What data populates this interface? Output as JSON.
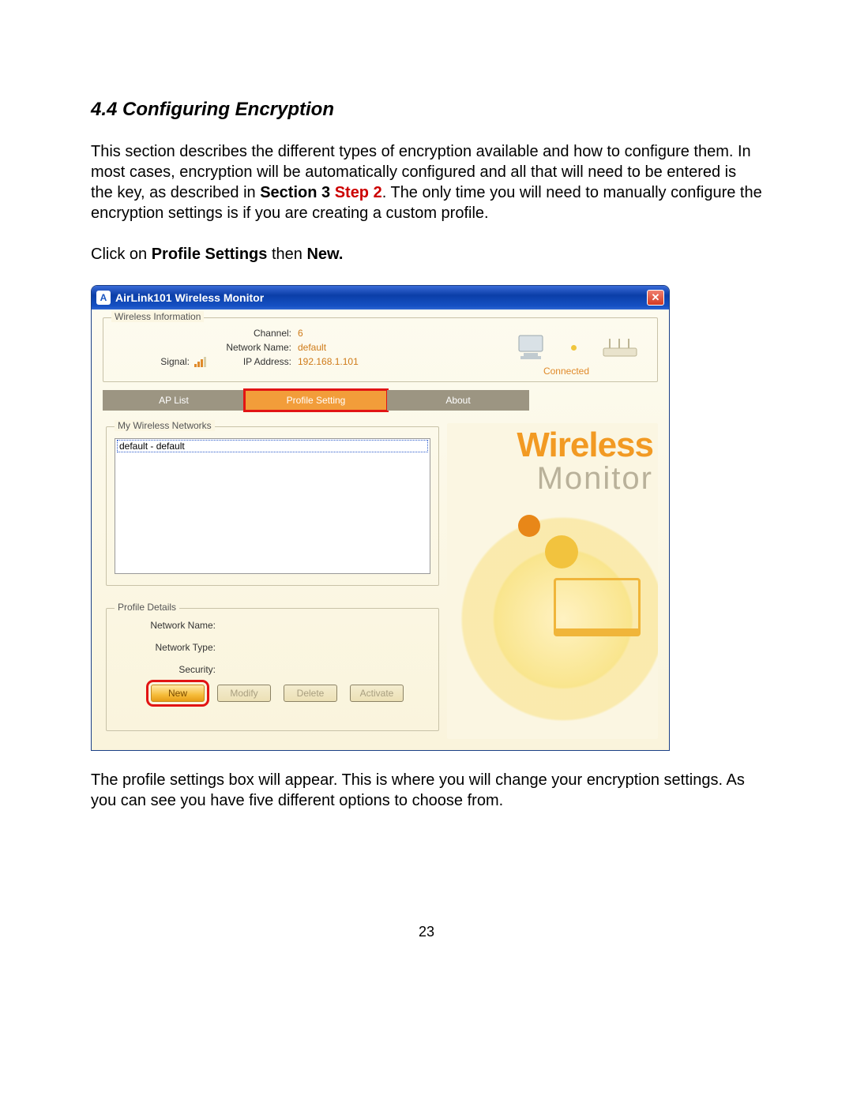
{
  "section_title": "4.4 Configuring Encryption",
  "para1_a": "This section describes the different types of encryption available and how to configure them.  In most cases, encryption will be automatically configured and all that will need to be entered is the key, as described in ",
  "para1_b_bold": "Section 3 ",
  "para1_b_step": "Step 2",
  "para1_c": ".  The only time you will need to manually configure the encryption settings is if you are creating a custom profile.",
  "para2_a": "Click on ",
  "para2_b": "Profile Settings",
  "para2_c": " then ",
  "para2_d": "New.",
  "para3": "The profile settings box will appear.  This is where you will change your encryption settings.  As you can see you have five different options to choose from.",
  "page_number": "23",
  "window": {
    "title": "AirLink101 Wireless Monitor",
    "icon_glyph": "A",
    "info_legend": "Wireless Information",
    "signal_label": "Signal:",
    "channel_label": "Channel:",
    "channel_value": "6",
    "netname_label": "Network Name:",
    "netname_value": "default",
    "ip_label": "IP Address:",
    "ip_value": "192.168.1.101",
    "connected": "Connected",
    "tabs": {
      "ap_list": "AP List",
      "profile_setting": "Profile Setting",
      "about": "About"
    },
    "networks_legend": "My Wireless Networks",
    "list_item": "default - default",
    "details_legend": "Profile Details",
    "detail_netname": "Network Name:",
    "detail_nettype": "Network Type:",
    "detail_security": "Security:",
    "buttons": {
      "new": "New",
      "modify": "Modify",
      "delete": "Delete",
      "activate": "Activate"
    },
    "brand_line1": "Wireless",
    "brand_line2": "Monitor"
  }
}
